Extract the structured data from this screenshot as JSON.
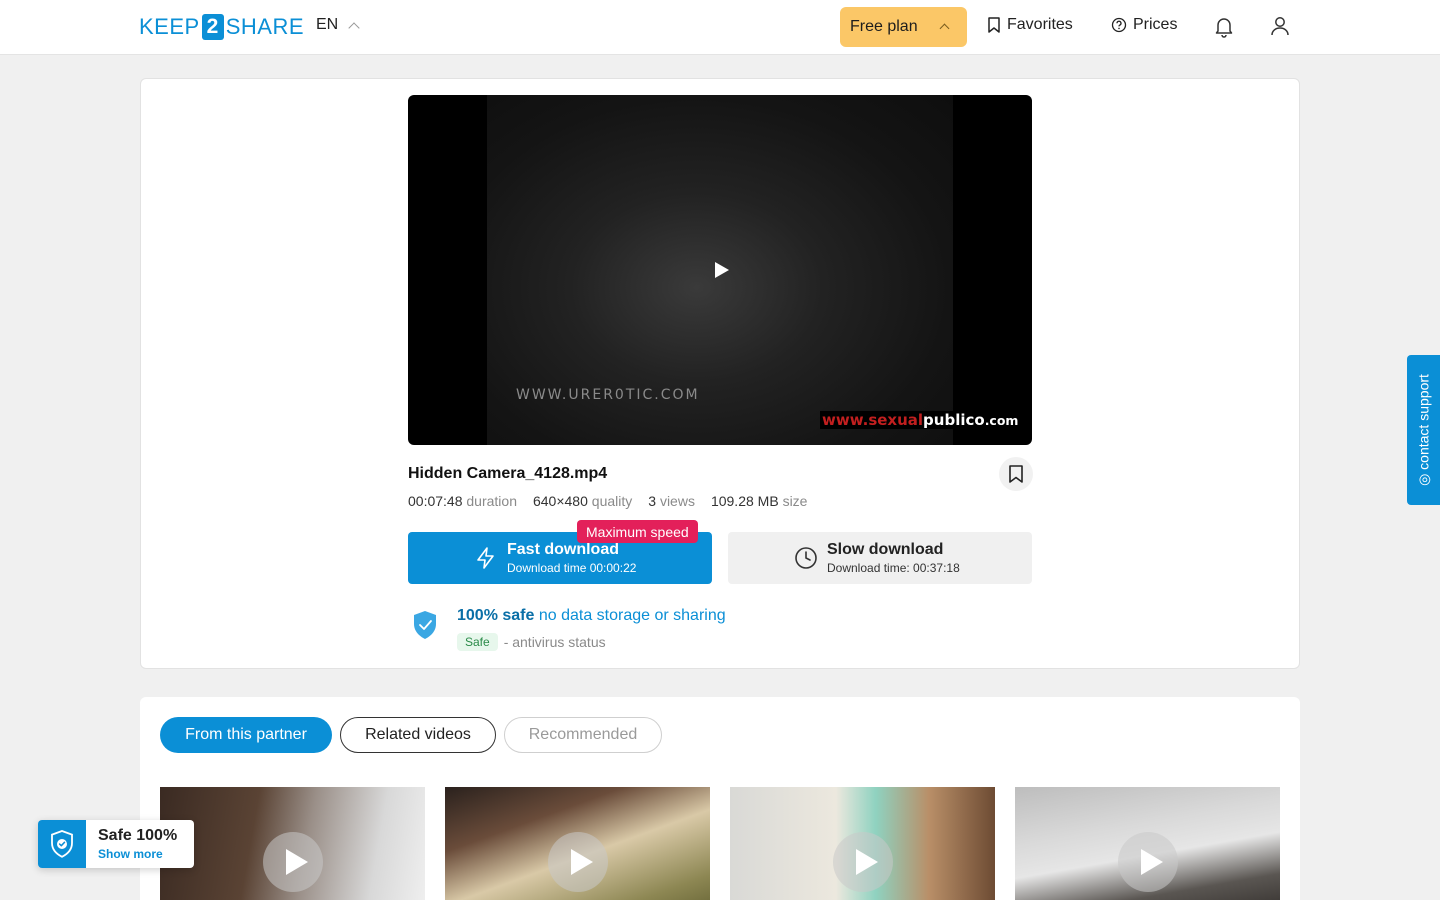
{
  "header": {
    "logo_left": "KEEP",
    "logo_num": "2",
    "logo_right": "SHARE",
    "language": "EN",
    "plan_label": "Free plan",
    "favorites_label": "Favorites",
    "prices_label": "Prices"
  },
  "video": {
    "watermark": "WWW.URER0TIC.COM",
    "brand_prefix": "www.",
    "brand_red": "sexual",
    "brand_white": "publico",
    "brand_suffix": ".com"
  },
  "file": {
    "name": "Hidden Camera_4128.mp4",
    "duration": "00:07:48",
    "duration_label": "duration",
    "quality": "640×480",
    "quality_label": "quality",
    "views": "3",
    "views_label": "views",
    "size": "109.28 MB",
    "size_label": "size"
  },
  "download": {
    "badge": "Maximum speed",
    "fast_label": "Fast download",
    "fast_time": "Download time 00:00:22",
    "slow_label": "Slow download",
    "slow_time": "Download time: 00:37:18"
  },
  "safety": {
    "safe_bold": "100% safe",
    "safe_text": "no data storage or sharing",
    "status_badge": "Safe",
    "status_text": "- antivirus status"
  },
  "support_label": "◎ contact support",
  "tabs": [
    "From this partner",
    "Related videos",
    "Recommended"
  ],
  "safe_widget": {
    "title": "Safe 100%",
    "link": "Show more"
  },
  "colors": {
    "accent": "#0b8fd6",
    "plan": "#fbc767",
    "badge": "#e3205a"
  }
}
